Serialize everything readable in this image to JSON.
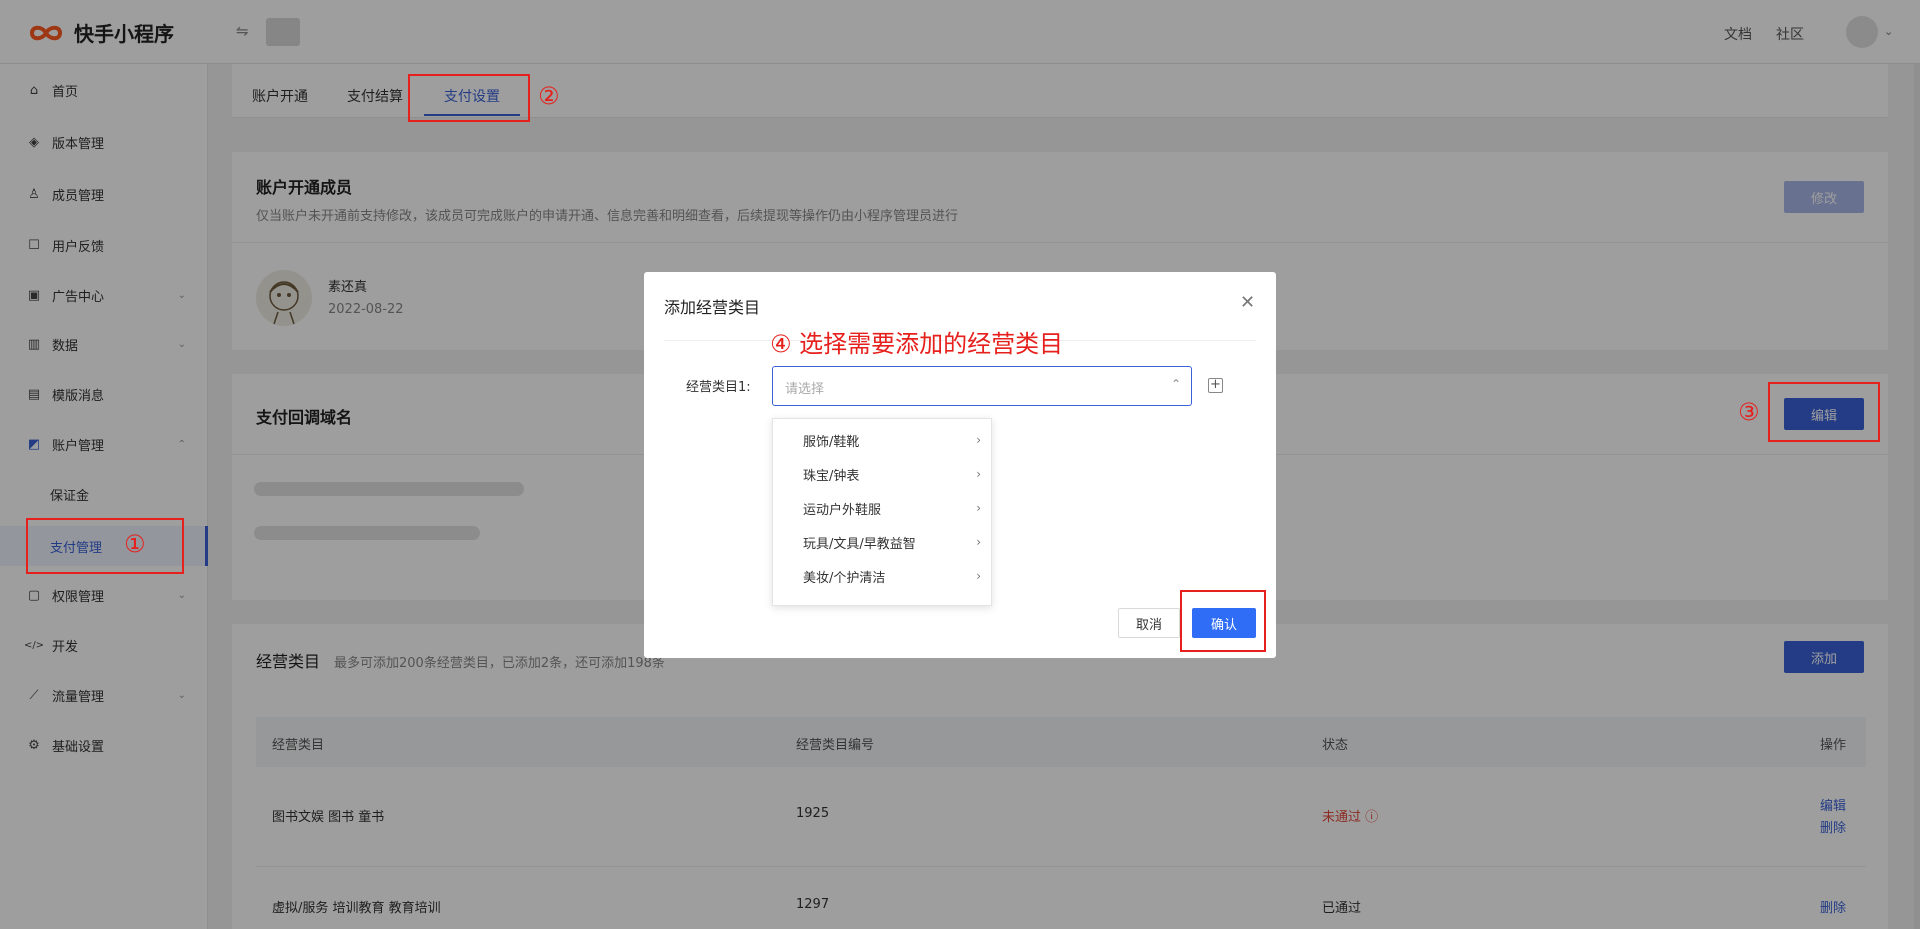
{
  "header": {
    "brand": "快手小程序",
    "switch_icon": "⇋",
    "nav": [
      "文档",
      "社区"
    ]
  },
  "sidebar": {
    "items": [
      {
        "label": "首页",
        "icon": "home-icon",
        "glyph": "⌂"
      },
      {
        "label": "版本管理",
        "icon": "layers-icon",
        "glyph": "◈"
      },
      {
        "label": "成员管理",
        "icon": "user-icon",
        "glyph": "♙"
      },
      {
        "label": "用户反馈",
        "icon": "comment-icon",
        "glyph": "☐"
      },
      {
        "label": "广告中心",
        "icon": "ad-icon",
        "glyph": "▣"
      },
      {
        "label": "数据",
        "icon": "chart-icon",
        "glyph": "▥"
      },
      {
        "label": "模版消息",
        "icon": "template-icon",
        "glyph": "▤"
      },
      {
        "label": "账户管理",
        "icon": "account-icon",
        "glyph": "◩"
      },
      {
        "label": "保证金"
      },
      {
        "label": "支付管理"
      },
      {
        "label": "权限管理",
        "icon": "lock-icon",
        "glyph": "▢"
      },
      {
        "label": "开发",
        "icon": "code-icon",
        "glyph": "</>"
      },
      {
        "label": "流量管理",
        "icon": "trend-icon",
        "glyph": "⟋"
      },
      {
        "label": "基础设置",
        "icon": "gear-icon",
        "glyph": "⚙"
      }
    ]
  },
  "tabs": [
    "账户开通",
    "支付结算",
    "支付设置"
  ],
  "member_card": {
    "title": "账户开通成员",
    "desc": "仅当账户未开通前支持修改，该成员可完成账户的申请开通、信息完善和明细查看，后续提现等操作仍由小程序管理员进行",
    "edit_label": "修改",
    "member_name": "素还真",
    "member_date": "2022-08-22"
  },
  "callback_card": {
    "title": "支付回调域名",
    "edit_label": "编辑"
  },
  "category_card": {
    "title": "经营类目",
    "desc": "最多可添加200条经营类目，已添加2条，还可添加198条",
    "add_label": "添加",
    "columns": [
      "经营类目",
      "经营类目编号",
      "状态",
      "操作"
    ],
    "rows": [
      {
        "name": "图书文娱 图书 童书",
        "code": "1925",
        "status": "未通过 ⓘ",
        "actions": [
          "编辑",
          "删除"
        ]
      },
      {
        "name": "虚拟/服务 培训教育 教育培训",
        "code": "1297",
        "status": "已通过",
        "actions": [
          "删除"
        ]
      }
    ]
  },
  "annotations": {
    "n1": "①",
    "n2": "②",
    "n3": "③",
    "n4": "④ 选择需要添加的经营类目"
  },
  "modal": {
    "title": "添加经营类目",
    "field_label": "经营类目1:",
    "placeholder": "请选择",
    "options": [
      "服饰/鞋靴",
      "珠宝/钟表",
      "运动户外鞋服",
      "玩具/文具/早教益智",
      "美妆/个护清洁"
    ],
    "cancel_label": "取消",
    "confirm_label": "确认"
  },
  "colors": {
    "primary": "#3a62d7",
    "annotation": "#e6201c",
    "brand": "#ff5a1f"
  }
}
